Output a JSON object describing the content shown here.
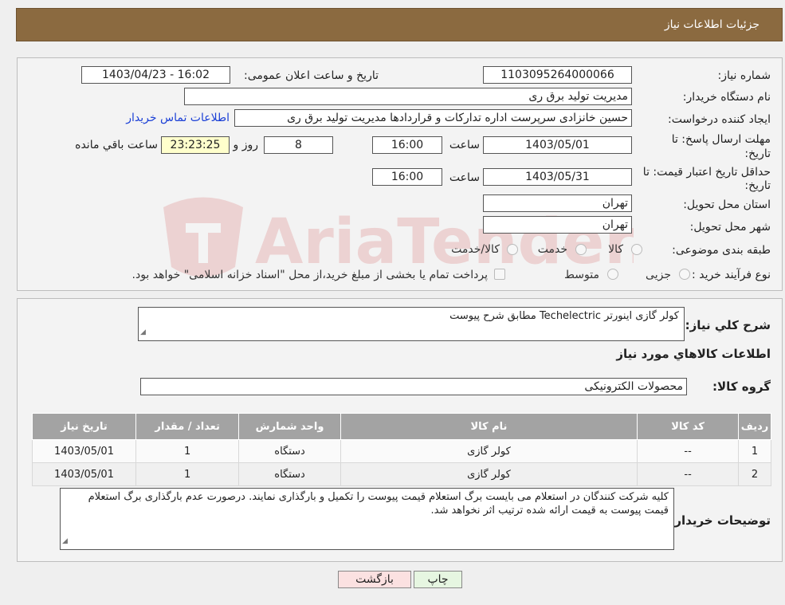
{
  "header": {
    "title": "جزئیات اطلاعات نیاز"
  },
  "form": {
    "need_number_label": "شماره نیاز:",
    "need_number": "1103095264000066",
    "announce_label": "تاریخ و ساعت اعلان عمومی:",
    "announce_value": "1403/04/23 - 16:02",
    "buyer_org_label": "نام دستگاه خریدار:",
    "buyer_org": "مدیریت تولید برق ری",
    "creator_label": "ایجاد کننده درخواست:",
    "creator": "حسین خانزادی سرپرست اداره تدارکات و قراردادها مدیریت تولید برق ری",
    "contact_link": "اطلاعات تماس خریدار",
    "deadline_label_1": "مهلت ارسال پاسخ: تا",
    "deadline_label_2": "تاریخ:",
    "deadline_date": "1403/05/01",
    "time_label": "ساعت",
    "deadline_time": "16:00",
    "days_value": "8",
    "days_label": "روز و",
    "remaining_time": "23:23:25",
    "remaining_label": "ساعت باقي مانده",
    "validity_label_1": "حداقل تاریخ اعتبار قیمت: تا",
    "validity_label_2": "تاریخ:",
    "validity_date": "1403/05/31",
    "validity_time": "16:00",
    "province_label": "استان محل تحویل:",
    "province": "تهران",
    "city_label": "شهر محل تحویل:",
    "city": "تهران",
    "category_label": "طبقه بندی موضوعی:",
    "category_options": [
      "کالا",
      "خدمت",
      "کالا/خدمت"
    ],
    "process_label": "نوع فرآیند خرید :",
    "process_options": [
      "جزیی",
      "متوسط"
    ],
    "payment_note": "پرداخت تمام یا بخشی از مبلغ خرید،از محل \"اسناد خزانه اسلامی\" خواهد بود."
  },
  "watermark": "AriaTender.neT",
  "summary": {
    "desc_label": "شرح کلي نياز:",
    "desc_value": "کولر گازی اینورتر  Techelectric مطابق شرح پیوست",
    "items_title": "اطلاعات کالاهاي مورد نياز",
    "group_label": "گروه کالا:",
    "group_value": "محصولات الکترونیکی"
  },
  "table": {
    "headers": [
      "ردیف",
      "کد کالا",
      "نام کالا",
      "واحد شمارش",
      "تعداد / مقدار",
      "تاریخ نیاز"
    ],
    "rows": [
      [
        "1",
        "--",
        "کولر گازی",
        "دستگاه",
        "1",
        "1403/05/01"
      ],
      [
        "2",
        "--",
        "کولر گازی",
        "دستگاه",
        "1",
        "1403/05/01"
      ]
    ]
  },
  "buyer_notes": {
    "label": "توضیحات خریدار:",
    "text": "کلیه شرکت کنندگان در استعلام می بایست برگ استعلام قیمت پیوست را تکمیل و بارگذاری نمایند. درصورت عدم بارگذاری برگ استعلام قیمت پیوست به قیمت ارائه شده ترتیب اثر نخواهد شد."
  },
  "buttons": {
    "print": "چاپ",
    "back": "بازگشت"
  }
}
